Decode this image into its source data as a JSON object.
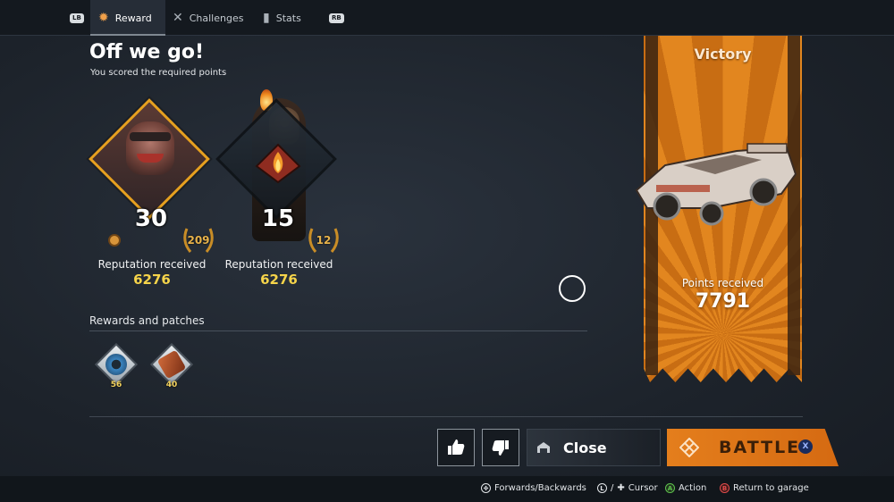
{
  "tabs": {
    "lb": "LB",
    "rb": "RB",
    "items": [
      {
        "label": "Reward",
        "icon": "reward-medal-icon",
        "active": true
      },
      {
        "label": "Challenges",
        "icon": "crossed-swords-icon",
        "active": false
      },
      {
        "label": "Stats",
        "icon": "stats-bars-icon",
        "active": false
      }
    ]
  },
  "header": {
    "title": "Off we go!",
    "subtitle": "You scored the required points"
  },
  "badges": [
    {
      "level": "30",
      "laurel_value": "209",
      "rep_label": "Reputation received",
      "rep_value": "6276"
    },
    {
      "level": "15",
      "laurel_value": "12",
      "rep_label": "Reputation received",
      "rep_value": "6276"
    }
  ],
  "rewards": {
    "title": "Rewards and patches",
    "items": [
      {
        "count": "56",
        "icon": "tire-icon"
      },
      {
        "count": "40",
        "icon": "patch-icon"
      }
    ]
  },
  "victory": {
    "title": "Victory",
    "points_label": "Points received",
    "points_value": "7791"
  },
  "actions": {
    "close_label": "Close",
    "battle_label": "BATTLE",
    "battle_key": "X"
  },
  "footer": {
    "hints": [
      {
        "label": "Forwards/Backwards"
      },
      {
        "label": "Cursor",
        "sep": "/"
      },
      {
        "label": "Action",
        "key": "A"
      },
      {
        "label": "Return to garage",
        "key": "B"
      }
    ]
  },
  "colors": {
    "accent_orange": "#e47e1c",
    "gold": "#f6d44a",
    "background": "#1f262f"
  }
}
